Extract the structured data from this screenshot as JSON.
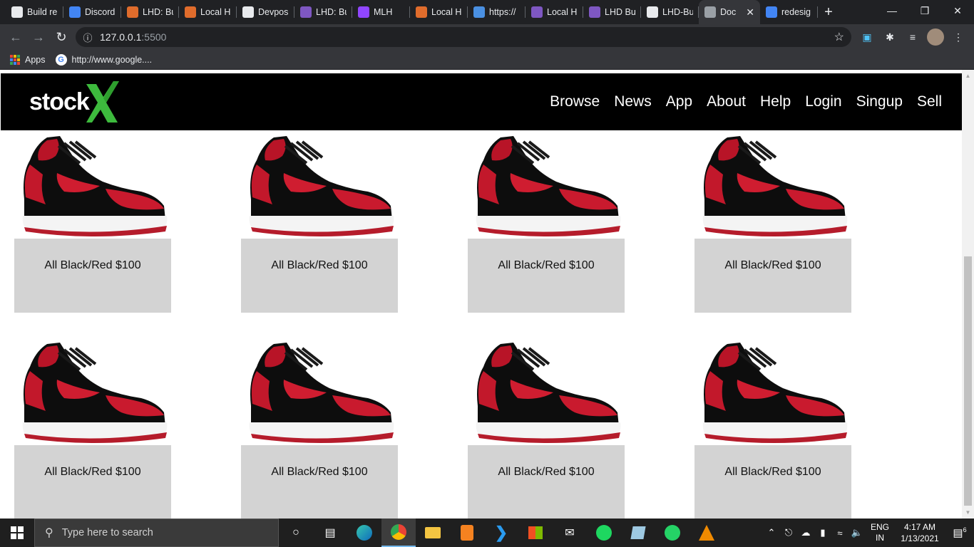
{
  "browser": {
    "tabs": [
      {
        "title": "Build re",
        "icon": "hex-icon",
        "color": "#e8eaed"
      },
      {
        "title": "Discord",
        "icon": "calendar-icon",
        "color": "#4285f4"
      },
      {
        "title": "LHD: Bu",
        "icon": "flag-icon",
        "color": "#e06c2c"
      },
      {
        "title": "Local H",
        "icon": "flag-icon",
        "color": "#e06c2c"
      },
      {
        "title": "Devpos",
        "icon": "devpost-icon",
        "color": "#e8eaed"
      },
      {
        "title": "LHD: Bu",
        "icon": "list-icon",
        "color": "#7e57c2"
      },
      {
        "title": "MLH",
        "icon": "twitch-icon",
        "color": "#9146ff"
      },
      {
        "title": "Local H",
        "icon": "flag-icon",
        "color": "#e06c2c"
      },
      {
        "title": "https://",
        "icon": "diamond-icon",
        "color": "#4a90e2"
      },
      {
        "title": "Local H",
        "icon": "list-icon",
        "color": "#7e57c2"
      },
      {
        "title": "LHD Bu",
        "icon": "list-icon",
        "color": "#7e57c2"
      },
      {
        "title": "LHD-Bu",
        "icon": "github-icon",
        "color": "#e8eaed"
      },
      {
        "title": "Doc",
        "icon": "globe-icon",
        "color": "#9aa0a6",
        "active": true
      },
      {
        "title": "redesig",
        "icon": "google-icon",
        "color": "#4285f4"
      }
    ],
    "url_host": "127.0.0.1",
    "url_port": ":5500",
    "bookmarks": [
      {
        "label": "Apps"
      },
      {
        "label": "http://www.google...."
      }
    ]
  },
  "site": {
    "logo_text": "stock",
    "logo_mark": "X",
    "brand_color": "#3dba3d",
    "nav": [
      "Browse",
      "News",
      "App",
      "About",
      "Help",
      "Login",
      "Singup",
      "Sell"
    ]
  },
  "products": [
    {
      "caption": "All Black/Red $100"
    },
    {
      "caption": "All Black/Red $100"
    },
    {
      "caption": "All Black/Red $100"
    },
    {
      "caption": "All Black/Red $100"
    },
    {
      "caption": "All Black/Red $100"
    },
    {
      "caption": "All Black/Red $100"
    },
    {
      "caption": "All Black/Red $100"
    },
    {
      "caption": "All Black/Red $100"
    }
  ],
  "taskbar": {
    "search_placeholder": "Type here to search",
    "lang_1": "ENG",
    "lang_2": "IN",
    "time": "4:17 AM",
    "date": "1/13/2021",
    "notifications": "6"
  }
}
